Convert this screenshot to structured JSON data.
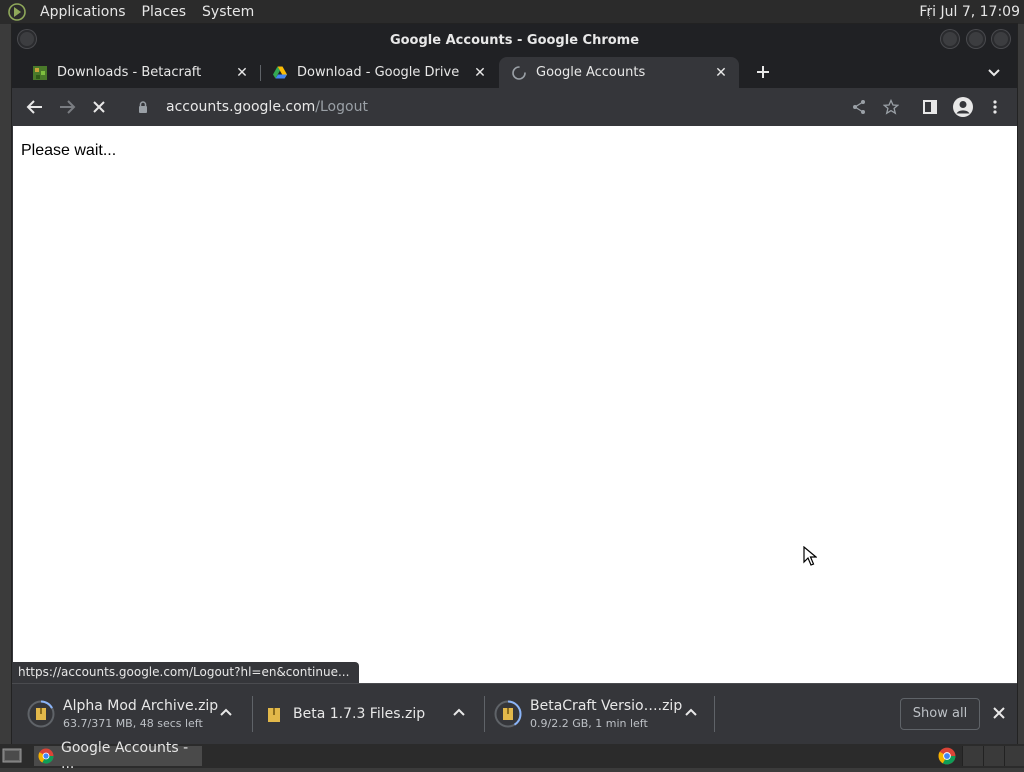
{
  "top_panel": {
    "menus": [
      "Applications",
      "Places",
      "System"
    ],
    "clock": "Fri Jul  7, 17:09"
  },
  "window": {
    "title": "Google Accounts - Google Chrome",
    "tabs": [
      {
        "label": "Downloads - Betacraft",
        "favicon": "betacraft-icon",
        "active": false
      },
      {
        "label": "Download - Google Drive",
        "favicon": "google-drive-icon",
        "active": false
      },
      {
        "label": "Google Accounts",
        "favicon": "loading-spinner-icon",
        "active": true
      }
    ],
    "omnibox": {
      "host": "accounts.google.com",
      "path": "/Logout"
    },
    "page_text": "Please wait...",
    "status_url": "https://accounts.google.com/Logout?hl=en&continue..."
  },
  "downloads": {
    "items": [
      {
        "name": "Alpha Mod Archive.zip",
        "status": "63.7/371 MB, 48 secs left",
        "icon": "file-zip-icon",
        "progress": 0.17
      },
      {
        "name": "Beta 1.7.3 Files.zip",
        "status": "",
        "icon": "file-zip-icon"
      },
      {
        "name": "BetaCraft Versio….zip",
        "status": "0.9/2.2 GB, 1 min left",
        "icon": "file-zip-icon",
        "progress": 0.41
      }
    ],
    "show_all": "Show all"
  },
  "taskbar": {
    "task_label": "Google Accounts - ..."
  },
  "colors": {
    "accent": "#8ab4f8",
    "chrome_dark": "#202124",
    "toolbar": "#35363a"
  }
}
